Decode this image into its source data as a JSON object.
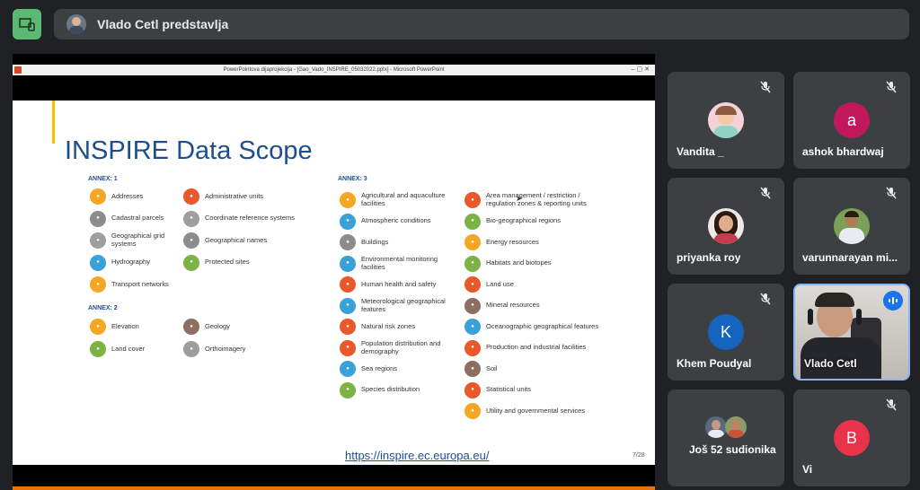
{
  "header": {
    "presenter_label": "Vlado Cetl predstavlja"
  },
  "window": {
    "title": "PowerPointova dijaprojekcija - [Gao_Vado_INSPIRE_05032022.pptx] - Microsoft PowerPoint",
    "controls": "–  ▢  ✕"
  },
  "slide": {
    "title": "INSPIRE Data Scope",
    "annex1_label": "ANNEX: 1",
    "annex2_label": "ANNEX: 2",
    "annex3_label": "ANNEX: 3",
    "annex1": [
      {
        "label": "Addresses",
        "color": "#f5a623"
      },
      {
        "label": "Cadastral parcels",
        "color": "#8c8c8c"
      },
      {
        "label": "Geographical grid systems",
        "color": "#9e9e9e"
      },
      {
        "label": "Hydrography",
        "color": "#3aa0d8"
      },
      {
        "label": "Transport networks",
        "color": "#f5a623"
      },
      {
        "label": "Administrative units",
        "color": "#e8582a"
      },
      {
        "label": "Coordinate reference systems",
        "color": "#9e9e9e"
      },
      {
        "label": "Geographical names",
        "color": "#8c8c8c"
      },
      {
        "label": "Protected sites",
        "color": "#7cb342"
      }
    ],
    "annex2": [
      {
        "label": "Elevation",
        "color": "#f5a623"
      },
      {
        "label": "Land cover",
        "color": "#7cb342"
      },
      {
        "label": "Geology",
        "color": "#8d6e63"
      },
      {
        "label": "Orthoimagery",
        "color": "#9e9e9e"
      }
    ],
    "annex3_left": [
      {
        "label": "Agricultural and aquaculture facilities",
        "color": "#f5a623"
      },
      {
        "label": "Atmospheric conditions",
        "color": "#3aa0d8"
      },
      {
        "label": "Buildings",
        "color": "#8c8c8c"
      },
      {
        "label": "Environmental monitoring facilities",
        "color": "#3aa0d8"
      },
      {
        "label": "Human health and safety",
        "color": "#e8582a"
      },
      {
        "label": "Meteorological geographical features",
        "color": "#3aa0d8"
      },
      {
        "label": "Natural risk zones",
        "color": "#e8582a"
      },
      {
        "label": "Population distribution and demography",
        "color": "#e8582a"
      },
      {
        "label": "Sea regions",
        "color": "#3aa0d8"
      },
      {
        "label": "Species distribution",
        "color": "#7cb342"
      }
    ],
    "annex3_right": [
      {
        "label": "Area management / restriction / regulation zones & reporting units",
        "color": "#e8582a"
      },
      {
        "label": "Bio-geographical regions",
        "color": "#7cb342"
      },
      {
        "label": "Energy resources",
        "color": "#f5a623"
      },
      {
        "label": "Habitats and biotopes",
        "color": "#7cb342"
      },
      {
        "label": "Land use",
        "color": "#e8582a"
      },
      {
        "label": "Mineral resources",
        "color": "#8d6e63"
      },
      {
        "label": "Oceanographic geographical features",
        "color": "#3aa0d8"
      },
      {
        "label": "Production and industrial facilities",
        "color": "#e8582a"
      },
      {
        "label": "Soil",
        "color": "#8d6e63"
      },
      {
        "label": "Statistical units",
        "color": "#e8582a"
      },
      {
        "label": "Utility and governmental services",
        "color": "#f5a623"
      }
    ],
    "link": "https://inspire.ec.europa.eu/",
    "page": "7/28"
  },
  "participants": {
    "vandita": {
      "name": "Vandita _"
    },
    "ashok": {
      "name": "ashok bhardwaj",
      "initial": "a",
      "color": "#c2185b"
    },
    "priyanka": {
      "name": "priyanka roy"
    },
    "varun": {
      "name": "varunnarayan mi..."
    },
    "khem": {
      "name": "Khem Poudyal",
      "initial": "K",
      "color": "#1565c0"
    },
    "vlado": {
      "name": "Vlado Cetl"
    },
    "others": {
      "name": "Još 52 sudionika"
    },
    "self": {
      "name": "Vi",
      "initial": "B",
      "color": "#e8334a"
    }
  }
}
